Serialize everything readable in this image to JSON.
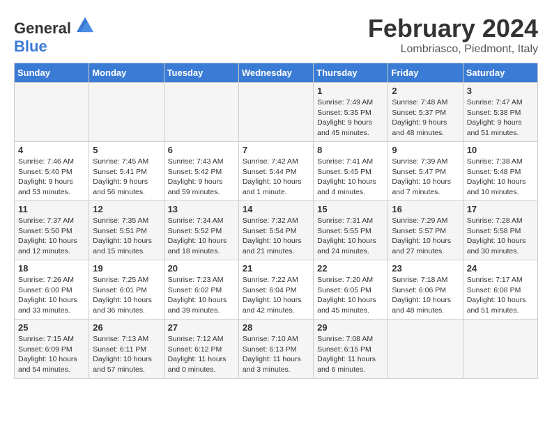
{
  "header": {
    "logo_general": "General",
    "logo_blue": "Blue",
    "month_year": "February 2024",
    "location": "Lombriasco, Piedmont, Italy"
  },
  "days_of_week": [
    "Sunday",
    "Monday",
    "Tuesday",
    "Wednesday",
    "Thursday",
    "Friday",
    "Saturday"
  ],
  "weeks": [
    [
      {
        "day": "",
        "info": ""
      },
      {
        "day": "",
        "info": ""
      },
      {
        "day": "",
        "info": ""
      },
      {
        "day": "",
        "info": ""
      },
      {
        "day": "1",
        "info": "Sunrise: 7:49 AM\nSunset: 5:35 PM\nDaylight: 9 hours\nand 45 minutes."
      },
      {
        "day": "2",
        "info": "Sunrise: 7:48 AM\nSunset: 5:37 PM\nDaylight: 9 hours\nand 48 minutes."
      },
      {
        "day": "3",
        "info": "Sunrise: 7:47 AM\nSunset: 5:38 PM\nDaylight: 9 hours\nand 51 minutes."
      }
    ],
    [
      {
        "day": "4",
        "info": "Sunrise: 7:46 AM\nSunset: 5:40 PM\nDaylight: 9 hours\nand 53 minutes."
      },
      {
        "day": "5",
        "info": "Sunrise: 7:45 AM\nSunset: 5:41 PM\nDaylight: 9 hours\nand 56 minutes."
      },
      {
        "day": "6",
        "info": "Sunrise: 7:43 AM\nSunset: 5:42 PM\nDaylight: 9 hours\nand 59 minutes."
      },
      {
        "day": "7",
        "info": "Sunrise: 7:42 AM\nSunset: 5:44 PM\nDaylight: 10 hours\nand 1 minute."
      },
      {
        "day": "8",
        "info": "Sunrise: 7:41 AM\nSunset: 5:45 PM\nDaylight: 10 hours\nand 4 minutes."
      },
      {
        "day": "9",
        "info": "Sunrise: 7:39 AM\nSunset: 5:47 PM\nDaylight: 10 hours\nand 7 minutes."
      },
      {
        "day": "10",
        "info": "Sunrise: 7:38 AM\nSunset: 5:48 PM\nDaylight: 10 hours\nand 10 minutes."
      }
    ],
    [
      {
        "day": "11",
        "info": "Sunrise: 7:37 AM\nSunset: 5:50 PM\nDaylight: 10 hours\nand 12 minutes."
      },
      {
        "day": "12",
        "info": "Sunrise: 7:35 AM\nSunset: 5:51 PM\nDaylight: 10 hours\nand 15 minutes."
      },
      {
        "day": "13",
        "info": "Sunrise: 7:34 AM\nSunset: 5:52 PM\nDaylight: 10 hours\nand 18 minutes."
      },
      {
        "day": "14",
        "info": "Sunrise: 7:32 AM\nSunset: 5:54 PM\nDaylight: 10 hours\nand 21 minutes."
      },
      {
        "day": "15",
        "info": "Sunrise: 7:31 AM\nSunset: 5:55 PM\nDaylight: 10 hours\nand 24 minutes."
      },
      {
        "day": "16",
        "info": "Sunrise: 7:29 AM\nSunset: 5:57 PM\nDaylight: 10 hours\nand 27 minutes."
      },
      {
        "day": "17",
        "info": "Sunrise: 7:28 AM\nSunset: 5:58 PM\nDaylight: 10 hours\nand 30 minutes."
      }
    ],
    [
      {
        "day": "18",
        "info": "Sunrise: 7:26 AM\nSunset: 6:00 PM\nDaylight: 10 hours\nand 33 minutes."
      },
      {
        "day": "19",
        "info": "Sunrise: 7:25 AM\nSunset: 6:01 PM\nDaylight: 10 hours\nand 36 minutes."
      },
      {
        "day": "20",
        "info": "Sunrise: 7:23 AM\nSunset: 6:02 PM\nDaylight: 10 hours\nand 39 minutes."
      },
      {
        "day": "21",
        "info": "Sunrise: 7:22 AM\nSunset: 6:04 PM\nDaylight: 10 hours\nand 42 minutes."
      },
      {
        "day": "22",
        "info": "Sunrise: 7:20 AM\nSunset: 6:05 PM\nDaylight: 10 hours\nand 45 minutes."
      },
      {
        "day": "23",
        "info": "Sunrise: 7:18 AM\nSunset: 6:06 PM\nDaylight: 10 hours\nand 48 minutes."
      },
      {
        "day": "24",
        "info": "Sunrise: 7:17 AM\nSunset: 6:08 PM\nDaylight: 10 hours\nand 51 minutes."
      }
    ],
    [
      {
        "day": "25",
        "info": "Sunrise: 7:15 AM\nSunset: 6:09 PM\nDaylight: 10 hours\nand 54 minutes."
      },
      {
        "day": "26",
        "info": "Sunrise: 7:13 AM\nSunset: 6:11 PM\nDaylight: 10 hours\nand 57 minutes."
      },
      {
        "day": "27",
        "info": "Sunrise: 7:12 AM\nSunset: 6:12 PM\nDaylight: 11 hours\nand 0 minutes."
      },
      {
        "day": "28",
        "info": "Sunrise: 7:10 AM\nSunset: 6:13 PM\nDaylight: 11 hours\nand 3 minutes."
      },
      {
        "day": "29",
        "info": "Sunrise: 7:08 AM\nSunset: 6:15 PM\nDaylight: 11 hours\nand 6 minutes."
      },
      {
        "day": "",
        "info": ""
      },
      {
        "day": "",
        "info": ""
      }
    ]
  ]
}
